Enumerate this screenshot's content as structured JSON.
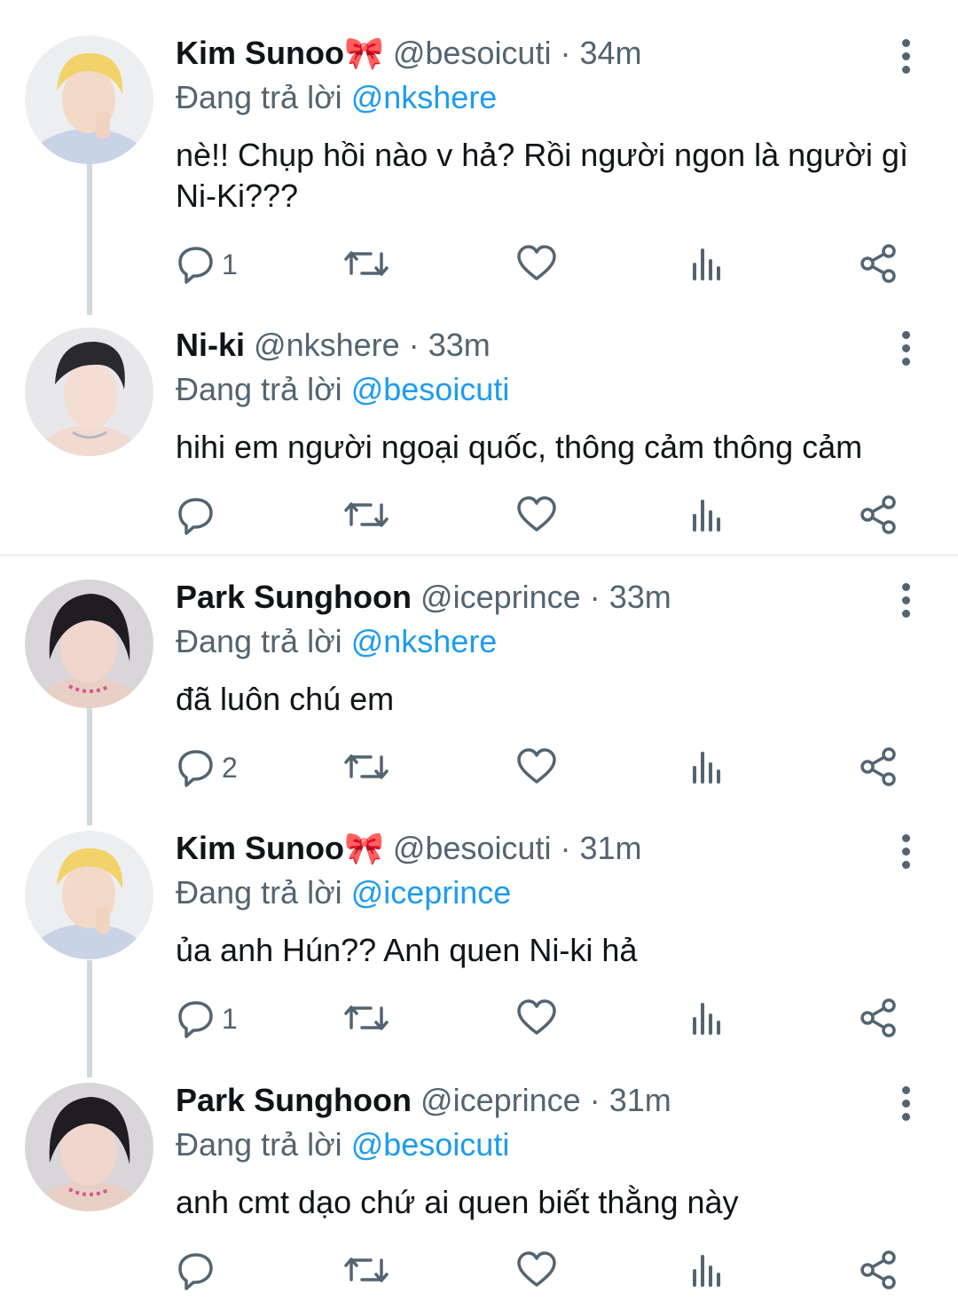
{
  "tweets": [
    {
      "name": "Kim Sunoo",
      "emoji": "🎀",
      "handle": "@besoicuti",
      "time": "34m",
      "reply_prefix": "Đang trả lời",
      "reply_to": "@nkshere",
      "text": "nè!! Chụp hồi nào v hả? Rồi người ngon là người gì Ni-Ki???",
      "replies": "1",
      "avatar_icon": "avatar-blond"
    },
    {
      "name": "Ni-ki",
      "emoji": "",
      "handle": "@nkshere",
      "time": "33m",
      "reply_prefix": "Đang trả lời",
      "reply_to": "@besoicuti",
      "text": "hihi em người ngoại quốc, thông cảm thông cảm",
      "replies": "",
      "avatar_icon": "avatar-dark"
    },
    {
      "name": "Park Sunghoon",
      "emoji": "",
      "handle": "@iceprince",
      "time": "33m",
      "reply_prefix": "Đang trả lời",
      "reply_to": "@nkshere",
      "text": "đã luôn chú em",
      "replies": "2",
      "avatar_icon": "avatar-dark-hair"
    },
    {
      "name": "Kim Sunoo",
      "emoji": "🎀",
      "handle": "@besoicuti",
      "time": "31m",
      "reply_prefix": "Đang trả lời",
      "reply_to": "@iceprince",
      "text": "ủa anh Hún?? Anh quen Ni-ki hả",
      "replies": "1",
      "avatar_icon": "avatar-blond"
    },
    {
      "name": "Park Sunghoon",
      "emoji": "",
      "handle": "@iceprince",
      "time": "31m",
      "reply_prefix": "Đang trả lời",
      "reply_to": "@besoicuti",
      "text": "anh cmt dạo chứ ai quen biết thằng này",
      "replies": "",
      "avatar_icon": "avatar-dark-hair"
    }
  ],
  "separator": "·",
  "colors": {
    "accent": "#1d9bf0",
    "muted": "#536471",
    "thread_line": "#cfd9de",
    "bow": "#e3488a"
  }
}
